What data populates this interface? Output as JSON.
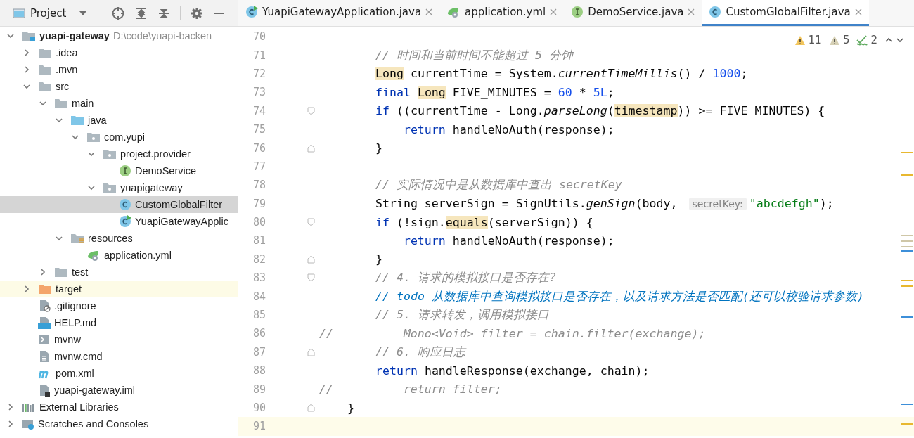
{
  "project_panel": {
    "title": "Project"
  },
  "tree": [
    {
      "label": "yuapi-gateway",
      "path": "D:\\code\\yuapi-backen",
      "kind": "module",
      "expanded": true,
      "selected": false,
      "children": [
        {
          "label": ".idea",
          "kind": "folder",
          "expanded": false,
          "selected": false
        },
        {
          "label": ".mvn",
          "kind": "folder",
          "expanded": false,
          "selected": false
        },
        {
          "label": "src",
          "kind": "folder",
          "expanded": true,
          "selected": false,
          "children": [
            {
              "label": "main",
              "kind": "folder",
              "expanded": true,
              "selected": false,
              "children": [
                {
                  "label": "java",
                  "kind": "sources",
                  "expanded": true,
                  "selected": false,
                  "children": [
                    {
                      "label": "com.yupi",
                      "kind": "package",
                      "expanded": true,
                      "selected": false,
                      "children": [
                        {
                          "label": "project.provider",
                          "kind": "package",
                          "expanded": true,
                          "selected": false,
                          "children": [
                            {
                              "label": "DemoService",
                              "kind": "interface",
                              "selected": false
                            }
                          ]
                        },
                        {
                          "label": "yuapigateway",
                          "kind": "package",
                          "expanded": true,
                          "selected": false,
                          "children": [
                            {
                              "label": "CustomGlobalFilter",
                              "kind": "class",
                              "selected": true
                            },
                            {
                              "label": "YuapiGatewayApplic",
                              "kind": "application",
                              "selected": false
                            }
                          ]
                        }
                      ]
                    }
                  ]
                },
                {
                  "label": "resources",
                  "kind": "resources",
                  "expanded": true,
                  "selected": false,
                  "children": [
                    {
                      "label": "application.yml",
                      "kind": "config",
                      "selected": false
                    }
                  ]
                }
              ]
            },
            {
              "label": "test",
              "kind": "folder",
              "expanded": false,
              "selected": false
            }
          ]
        },
        {
          "label": "target",
          "kind": "excluded",
          "expanded": false,
          "selected": false
        },
        {
          "label": ".gitignore",
          "kind": "ignore",
          "selected": false
        },
        {
          "label": "HELP.md",
          "kind": "markdown",
          "selected": false
        },
        {
          "label": "mvnw",
          "kind": "shell",
          "selected": false
        },
        {
          "label": "mvnw.cmd",
          "kind": "text",
          "selected": false
        },
        {
          "label": "pom.xml",
          "kind": "maven",
          "selected": false
        },
        {
          "label": "yuapi-gateway.iml",
          "kind": "iml",
          "selected": false
        }
      ]
    },
    {
      "label": "External Libraries",
      "kind": "libraries",
      "expanded": false,
      "selected": false
    },
    {
      "label": "Scratches and Consoles",
      "kind": "scratches",
      "expanded": false,
      "selected": false
    }
  ],
  "editor_tabs": [
    {
      "label": "YuapiGatewayApplication.java",
      "kind": "application",
      "selected": false
    },
    {
      "label": "application.yml",
      "kind": "config",
      "selected": false
    },
    {
      "label": "DemoService.java",
      "kind": "interface",
      "selected": false
    },
    {
      "label": "CustomGlobalFilter.java",
      "kind": "class",
      "selected": true
    }
  ],
  "inspections": [
    {
      "kind": "warning",
      "count": "11"
    },
    {
      "kind": "weak-warning",
      "count": "5"
    },
    {
      "kind": "typo",
      "count": "2"
    }
  ],
  "code_lines": [
    {
      "n": "70",
      "kind": "plain",
      "current": false
    },
    {
      "n": "71",
      "kind": "plain",
      "current": false,
      "tokens": [
        {
          "kind": "comment",
          "text": "        // 时间和当前时间不能超过 5 分钟"
        }
      ]
    },
    {
      "n": "72",
      "kind": "plain",
      "current": false,
      "tokens": [
        {
          "kind": "usage",
          "text": "        Long"
        },
        {
          "kind": "text",
          "text": " currentTime = System."
        },
        {
          "kind": "call",
          "text": "currentTimeMillis"
        },
        {
          "kind": "text",
          "text": "() / "
        },
        {
          "kind": "number",
          "text": "1000"
        },
        {
          "kind": "text",
          "text": ";"
        }
      ]
    },
    {
      "n": "73",
      "kind": "plain",
      "current": false,
      "tokens": [
        {
          "kind": "keyword",
          "text": "        final "
        },
        {
          "kind": "usage",
          "text": "Long"
        },
        {
          "kind": "text",
          "text": " FIVE_MINUTES = "
        },
        {
          "kind": "number",
          "text": "60"
        },
        {
          "kind": "text",
          "text": " * "
        },
        {
          "kind": "number",
          "text": "5L"
        },
        {
          "kind": "text",
          "text": ";"
        }
      ]
    },
    {
      "n": "74",
      "kind": "fold-start",
      "current": false,
      "tokens": [
        {
          "kind": "keyword",
          "text": "        if"
        },
        {
          "kind": "text",
          "text": " ((currentTime - Long."
        },
        {
          "kind": "call",
          "text": "parseLong"
        },
        {
          "kind": "text",
          "text": "("
        },
        {
          "kind": "usage",
          "text": "timestamp"
        },
        {
          "kind": "text",
          "text": ")) >= FIVE_MINUTES) {"
        }
      ]
    },
    {
      "n": "75",
      "kind": "plain",
      "current": false,
      "tokens": [
        {
          "kind": "keyword",
          "text": "            return"
        },
        {
          "kind": "text",
          "text": " handleNoAuth(response);"
        }
      ]
    },
    {
      "n": "76",
      "kind": "fold-end",
      "current": false,
      "tokens": [
        {
          "kind": "text",
          "text": "        }"
        }
      ]
    },
    {
      "n": "77",
      "kind": "plain",
      "current": false
    },
    {
      "n": "78",
      "kind": "plain",
      "current": false,
      "tokens": [
        {
          "kind": "comment",
          "text": "        // 实际情况中是从数据库中查出 secretKey"
        }
      ]
    },
    {
      "n": "79",
      "kind": "plain",
      "current": false,
      "tokens": [
        {
          "kind": "text",
          "text": "        String serverSign = SignUtils."
        },
        {
          "kind": "call",
          "text": "genSign"
        },
        {
          "kind": "text",
          "text": "(body, "
        },
        {
          "kind": "hint",
          "text": "secretKey:"
        },
        {
          "kind": "string",
          "text": "\"abcdefgh\""
        },
        {
          "kind": "text",
          "text": ");"
        }
      ]
    },
    {
      "n": "80",
      "kind": "fold-start",
      "current": false,
      "tokens": [
        {
          "kind": "keyword",
          "text": "        if"
        },
        {
          "kind": "text",
          "text": " (!sign."
        },
        {
          "kind": "usage",
          "text": "equals"
        },
        {
          "kind": "text",
          "text": "(serverSign)) {"
        }
      ]
    },
    {
      "n": "81",
      "kind": "plain",
      "current": false,
      "tokens": [
        {
          "kind": "keyword",
          "text": "            return"
        },
        {
          "kind": "text",
          "text": " handleNoAuth(response);"
        }
      ]
    },
    {
      "n": "82",
      "kind": "fold-end",
      "current": false,
      "tokens": [
        {
          "kind": "text",
          "text": "        }"
        }
      ]
    },
    {
      "n": "83",
      "kind": "fold-start",
      "current": false,
      "tokens": [
        {
          "kind": "comment",
          "text": "        // 4. 请求的模拟接口是否存在?"
        }
      ]
    },
    {
      "n": "84",
      "kind": "plain",
      "current": false,
      "tokens": [
        {
          "kind": "todo",
          "text": "        // todo 从数据库中查询模拟接口是否存在，以及请求方法是否匹配(还可以校验请求参数)"
        }
      ]
    },
    {
      "n": "85",
      "kind": "plain",
      "current": false,
      "tokens": [
        {
          "kind": "comment",
          "text": "        // 5. 请求转发，调用模拟接口"
        }
      ]
    },
    {
      "n": "86",
      "kind": "plain",
      "current": false,
      "tokens": [
        {
          "kind": "comment",
          "text": "//          Mono<Void> filter = chain.filter(exchange);"
        }
      ]
    },
    {
      "n": "87",
      "kind": "fold-end",
      "current": false,
      "tokens": [
        {
          "kind": "comment",
          "text": "        // 6. 响应日志"
        }
      ]
    },
    {
      "n": "88",
      "kind": "plain",
      "current": false,
      "tokens": [
        {
          "kind": "keyword",
          "text": "        return"
        },
        {
          "kind": "text",
          "text": " handleResponse(exchange, chain);"
        }
      ]
    },
    {
      "n": "89",
      "kind": "plain",
      "current": false,
      "tokens": [
        {
          "kind": "comment",
          "text": "//          return filter;"
        }
      ]
    },
    {
      "n": "90",
      "kind": "fold-end",
      "current": false,
      "tokens": [
        {
          "kind": "text",
          "text": "    }"
        }
      ]
    },
    {
      "n": "91",
      "kind": "plain",
      "current": true
    }
  ]
}
